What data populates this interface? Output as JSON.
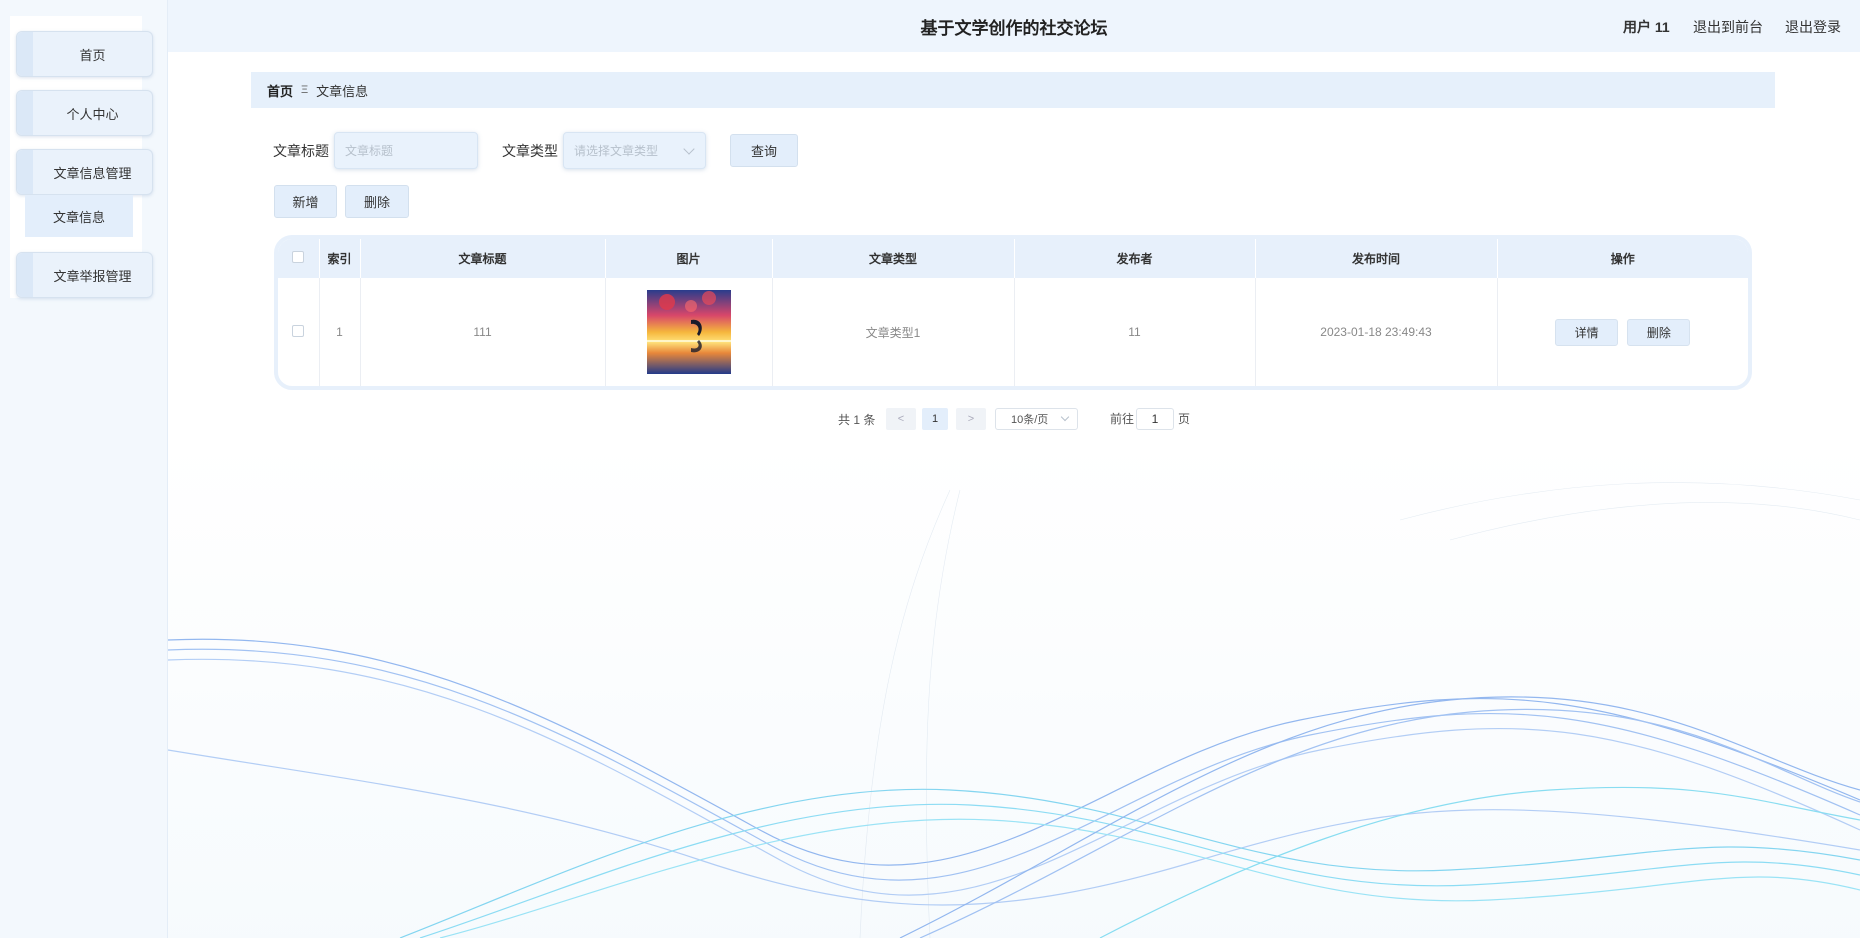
{
  "header": {
    "title": "基于文学创作的社交论坛",
    "user": "用户 11",
    "exit_front": "退出到前台",
    "logout": "退出登录"
  },
  "sidebar": {
    "items": [
      {
        "label": "首页"
      },
      {
        "label": "个人中心"
      },
      {
        "label": "文章信息管理"
      },
      {
        "label": "文章举报管理"
      }
    ],
    "subitem": "文章信息"
  },
  "breadcrumb": {
    "home": "首页",
    "separator": "Ξ",
    "current": "文章信息"
  },
  "search": {
    "title_label": "文章标题",
    "title_placeholder": "文章标题",
    "type_label": "文章类型",
    "type_placeholder": "请选择文章类型",
    "query_button": "查询"
  },
  "actions": {
    "add": "新增",
    "delete": "删除"
  },
  "table": {
    "headers": [
      "索引",
      "文章标题",
      "图片",
      "文章类型",
      "发布者",
      "发布时间",
      "操作"
    ],
    "rows": [
      {
        "index": "1",
        "title": "111",
        "image": "thumbnail",
        "type": "文章类型1",
        "publisher": "11",
        "time": "2023-01-18 23:49:43",
        "detail": "详情",
        "delete": "删除"
      }
    ]
  },
  "pagination": {
    "total": "共 1 条",
    "prev": "<",
    "page": "1",
    "next": ">",
    "page_size": "10条/页",
    "goto_label": "前往",
    "goto_value": "1",
    "page_suffix": "页"
  },
  "colors": {
    "accent": "#e3eefb",
    "header_bg": "#eef5fd",
    "wave_blue": "#4a86e8",
    "wave_cyan": "#2ec5e8"
  }
}
